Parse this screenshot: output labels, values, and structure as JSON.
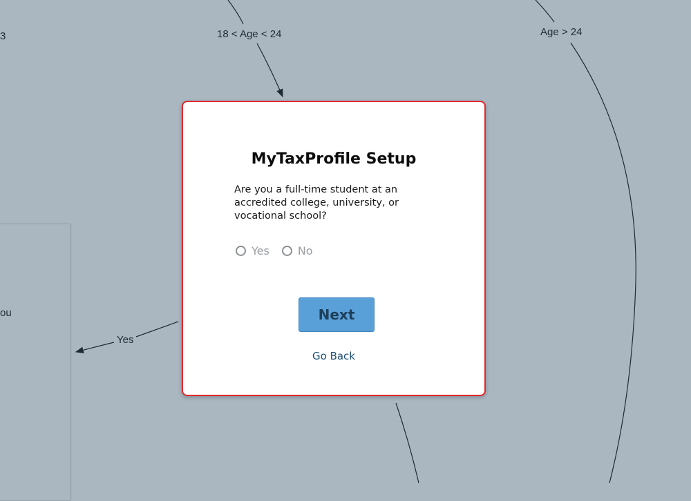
{
  "background_flowchart": {
    "edge_labels": {
      "age_between": "18 < Age < 24",
      "age_over": "Age > 24",
      "yes": "Yes"
    },
    "side_box_text": "ou",
    "top_left_fragment": "3"
  },
  "dialog": {
    "title": "MyTaxProfile Setup",
    "question": "Are you a full-time student at an accredited college, university, or vocational school?",
    "options": [
      {
        "label": "Yes",
        "selected": false
      },
      {
        "label": "No",
        "selected": false
      }
    ],
    "next_label": "Next",
    "go_back_label": "Go Back"
  },
  "colors": {
    "background": "#aab7c0",
    "dialog_border": "#e0282e",
    "next_button": "#5aa0d8",
    "link": "#1e4d73"
  }
}
